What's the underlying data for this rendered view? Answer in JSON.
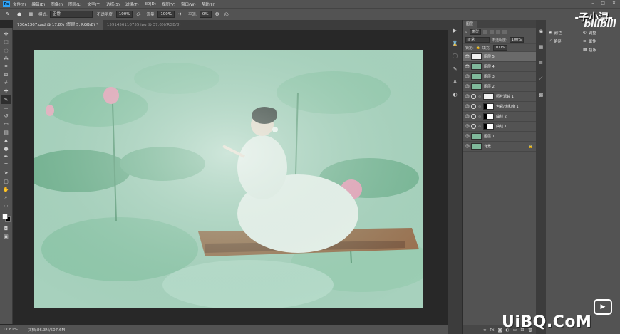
{
  "menubar": {
    "items": [
      "文件(F)",
      "编辑(E)",
      "图像(I)",
      "图层(L)",
      "文字(Y)",
      "选择(S)",
      "滤镜(T)",
      "3D(D)",
      "视图(V)",
      "窗口(W)",
      "帮助(H)"
    ],
    "logo": "Ps"
  },
  "optionsbar": {
    "mode_label": "模式:",
    "mode_value": "正常",
    "opacity_label": "不透明度:",
    "opacity_value": "100%",
    "flow_label": "流量:",
    "flow_value": "100%",
    "smooth_label": "平滑:",
    "smooth_value": "0%"
  },
  "tabs": [
    {
      "label": "730A1367.psd @ 17.8% (图层 5, RGB/8) *"
    },
    {
      "label": "1591456116755.jpg @ 37.6%(RGB/8)"
    }
  ],
  "status": {
    "zoom": "17.81%",
    "doc": "文档:86.3M/507.6M"
  },
  "layers_panel": {
    "tab": "图层",
    "filter_label": "类型",
    "blend_mode": "正常",
    "opacity_label": "不透明度:",
    "opacity_value": "100%",
    "lock_label": "锁定:",
    "fill_label": "填充:",
    "fill_value": "100%",
    "layers": [
      {
        "name": "图层 5",
        "thumb": "white",
        "active": true
      },
      {
        "name": "图层 4",
        "thumb": "photo",
        "active": false
      },
      {
        "name": "图层 3",
        "thumb": "photo",
        "active": false
      },
      {
        "name": "图层 2",
        "thumb": "photo",
        "active": false
      },
      {
        "name": "照片滤镜 1",
        "thumb": "white",
        "active": false
      },
      {
        "name": "色彩/饱和度 1",
        "thumb": "mask",
        "active": false
      },
      {
        "name": "曲线 2",
        "thumb": "mask",
        "active": false
      },
      {
        "name": "曲线 1",
        "thumb": "mask",
        "active": false
      },
      {
        "name": "图层 1",
        "thumb": "photo",
        "active": false
      },
      {
        "name": "背景",
        "thumb": "photo",
        "active": false
      }
    ]
  },
  "props_panel": {
    "items": [
      "颜色",
      "调整",
      "属性",
      "路径",
      "色板"
    ]
  },
  "watermarks": {
    "author": "-子小浔-",
    "site": "bilibili",
    "brand": "UiBQ.CoM"
  }
}
